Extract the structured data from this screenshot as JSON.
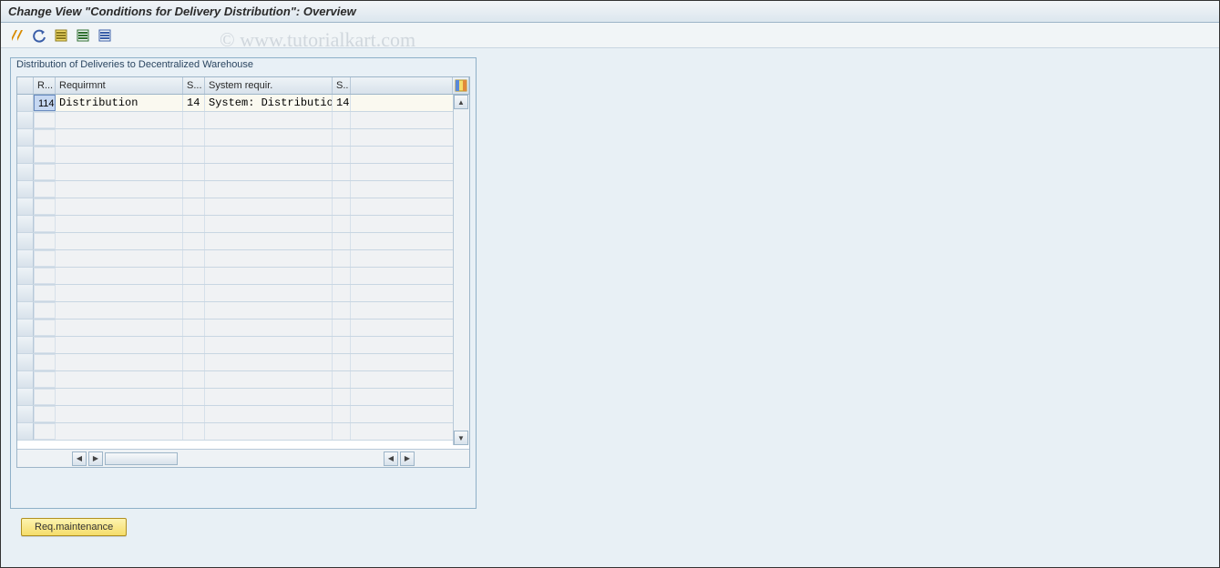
{
  "window": {
    "title": "Change View \"Conditions for Delivery Distribution\": Overview"
  },
  "watermark": "© www.tutorialkart.com",
  "toolbar_icons": [
    "other-view-icon",
    "undo-changes-icon",
    "select-all-icon",
    "new-entries-icon",
    "delete-icon"
  ],
  "group": {
    "title": "Distribution of Deliveries to Decentralized Warehouse",
    "columns": {
      "r": "R...",
      "requirmnt": "Requirmnt",
      "s": "S...",
      "system_requir": "System requir.",
      "s2": "S.."
    },
    "rows": [
      {
        "r": "114",
        "requirmnt": "Distribution",
        "s": "14",
        "system_requir": "System: Distribution",
        "s2": "14"
      }
    ]
  },
  "button": {
    "req_maintenance": "Req.maintenance"
  }
}
